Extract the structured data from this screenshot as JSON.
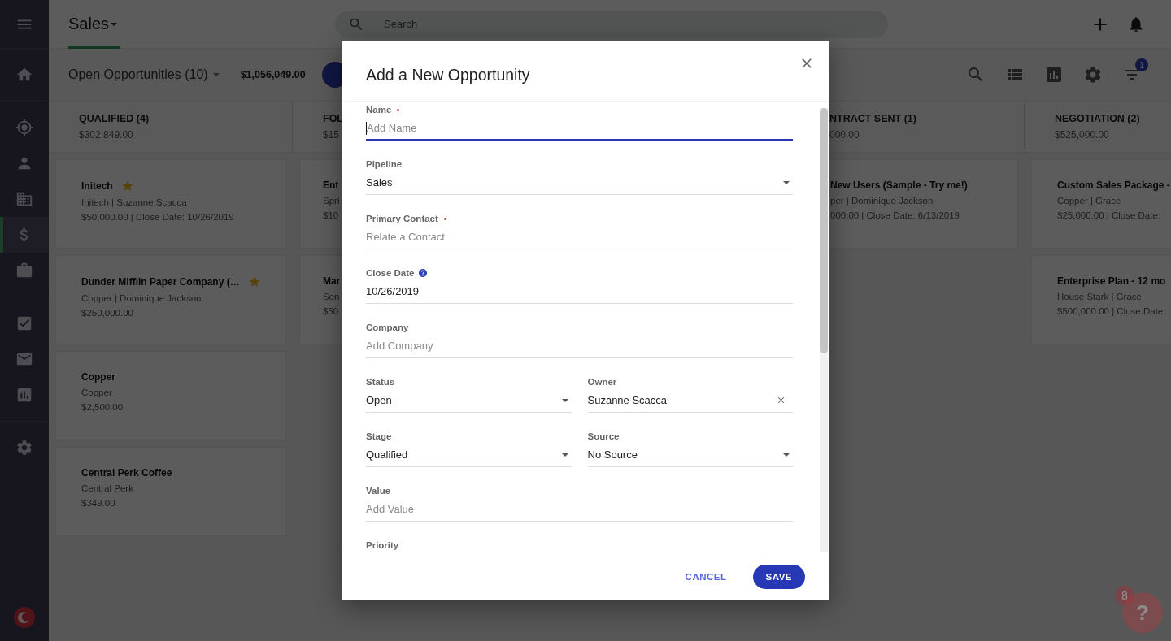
{
  "sidebar": {
    "menu": true,
    "groups": [
      {
        "items": [
          {
            "kind": "home",
            "selected": false
          }
        ]
      },
      {
        "items": [
          {
            "kind": "target",
            "selected": false
          },
          {
            "kind": "person",
            "selected": false
          },
          {
            "kind": "building",
            "selected": false
          },
          {
            "kind": "dollar",
            "selected": true
          },
          {
            "kind": "briefcase",
            "selected": false
          }
        ]
      },
      {
        "items": [
          {
            "kind": "tasks",
            "selected": false
          },
          {
            "kind": "mail",
            "selected": false
          },
          {
            "kind": "reports",
            "selected": false
          }
        ]
      },
      {
        "items": [
          {
            "kind": "settings",
            "selected": false
          }
        ]
      }
    ]
  },
  "header": {
    "title": "Sales",
    "selected": true,
    "search": {
      "placeholder": "Search"
    }
  },
  "toolbar": {
    "view": "Open Opportunities (10)",
    "total": "$1,056,049.00",
    "filter_badge": "1"
  },
  "board": {
    "columns": [
      {
        "kind": "cut_right",
        "title": "QUALIFIED (4)",
        "amount": "$302,849.00",
        "cards": [
          {
            "title": "Initech",
            "starred": true,
            "line1": "Initech | Suzanne Scacca",
            "line2": "$50,000.00 | Close Date: 10/26/2019"
          },
          {
            "title": "Dunder Mifflin Paper Company (…",
            "starred": true,
            "line1": "Copper | Dominique Jackson",
            "line2": "$250,000.00"
          },
          {
            "title": "Copper",
            "starred": false,
            "line1": "Copper",
            "line2": "$2,500.00"
          },
          {
            "title": "Central Perk Coffee",
            "starred": false,
            "line1": "Central Perk",
            "line2": "$349.00"
          }
        ]
      },
      {
        "kind": "cut_right",
        "title": "FOL",
        "amount": "$15",
        "cards": [
          {
            "title": "Ent",
            "line1": "Spri",
            "line2": "$10"
          },
          {
            "title": "Mar",
            "line1": "Sen",
            "line2": "$50"
          }
        ]
      },
      {
        "kind": "cut_left",
        "title": "NTRACT SENT (1)",
        "amount": "000.00",
        "cards": [
          {
            "title": "New Users (Sample - Try me!)",
            "starred": false,
            "line1": "per | Dominique Jackson",
            "line2": "000.00 | Close Date: 6/13/2019"
          }
        ]
      },
      {
        "kind": "cut_right",
        "title": "NEGOTIATION (2)",
        "amount": "$525,000.00",
        "cards": [
          {
            "title": "Custom Sales Package -",
            "starred": false,
            "line1": "Copper | Grace",
            "line2": "$25,000.00 | Close Date:"
          },
          {
            "title": "Enterprise Plan - 12 mo",
            "starred": false,
            "line1": "House Stark | Grace",
            "line2": "$500,000.00 | Close Date:"
          }
        ]
      }
    ]
  },
  "dialog": {
    "title": "Add a New Opportunity",
    "rows": [
      {
        "fields": [
          {
            "label": "Name",
            "required": true,
            "kind": "text",
            "placeholder": "Add Name",
            "focused": true
          }
        ]
      },
      {
        "fields": [
          {
            "label": "Pipeline",
            "required": false,
            "kind": "select",
            "value": "Sales",
            "focused": false
          }
        ]
      },
      {
        "fields": [
          {
            "label": "Primary Contact",
            "required": true,
            "kind": "text",
            "placeholder": "Relate a Contact",
            "focused": false
          }
        ]
      },
      {
        "fields": [
          {
            "label": "Close Date",
            "required": false,
            "help": true,
            "kind": "text",
            "value": "10/26/2019",
            "focused": false
          }
        ]
      },
      {
        "fields": [
          {
            "label": "Company",
            "required": false,
            "kind": "text",
            "placeholder": "Add Company",
            "focused": false
          }
        ]
      },
      {
        "fields": [
          {
            "label": "Status",
            "required": false,
            "kind": "select",
            "value": "Open",
            "focused": false
          },
          {
            "label": "Owner",
            "required": false,
            "kind": "text",
            "value": "Suzanne Scacca",
            "clearable": true,
            "focused": false
          }
        ]
      },
      {
        "fields": [
          {
            "label": "Stage",
            "required": false,
            "kind": "select",
            "value": "Qualified",
            "focused": false
          },
          {
            "label": "Source",
            "required": false,
            "kind": "select",
            "value": "No Source",
            "focused": false
          }
        ]
      },
      {
        "fields": [
          {
            "label": "Value",
            "required": false,
            "kind": "text",
            "placeholder": "Add Value",
            "focused": false
          }
        ]
      },
      {
        "fields": [
          {
            "label": "Priority",
            "required": false,
            "kind": "label_only"
          }
        ]
      }
    ],
    "buttons": [
      {
        "kind": "text",
        "label": "CANCEL"
      },
      {
        "kind": "primary",
        "label": "SAVE"
      }
    ]
  },
  "help": {
    "badge": "8",
    "label": "?"
  }
}
